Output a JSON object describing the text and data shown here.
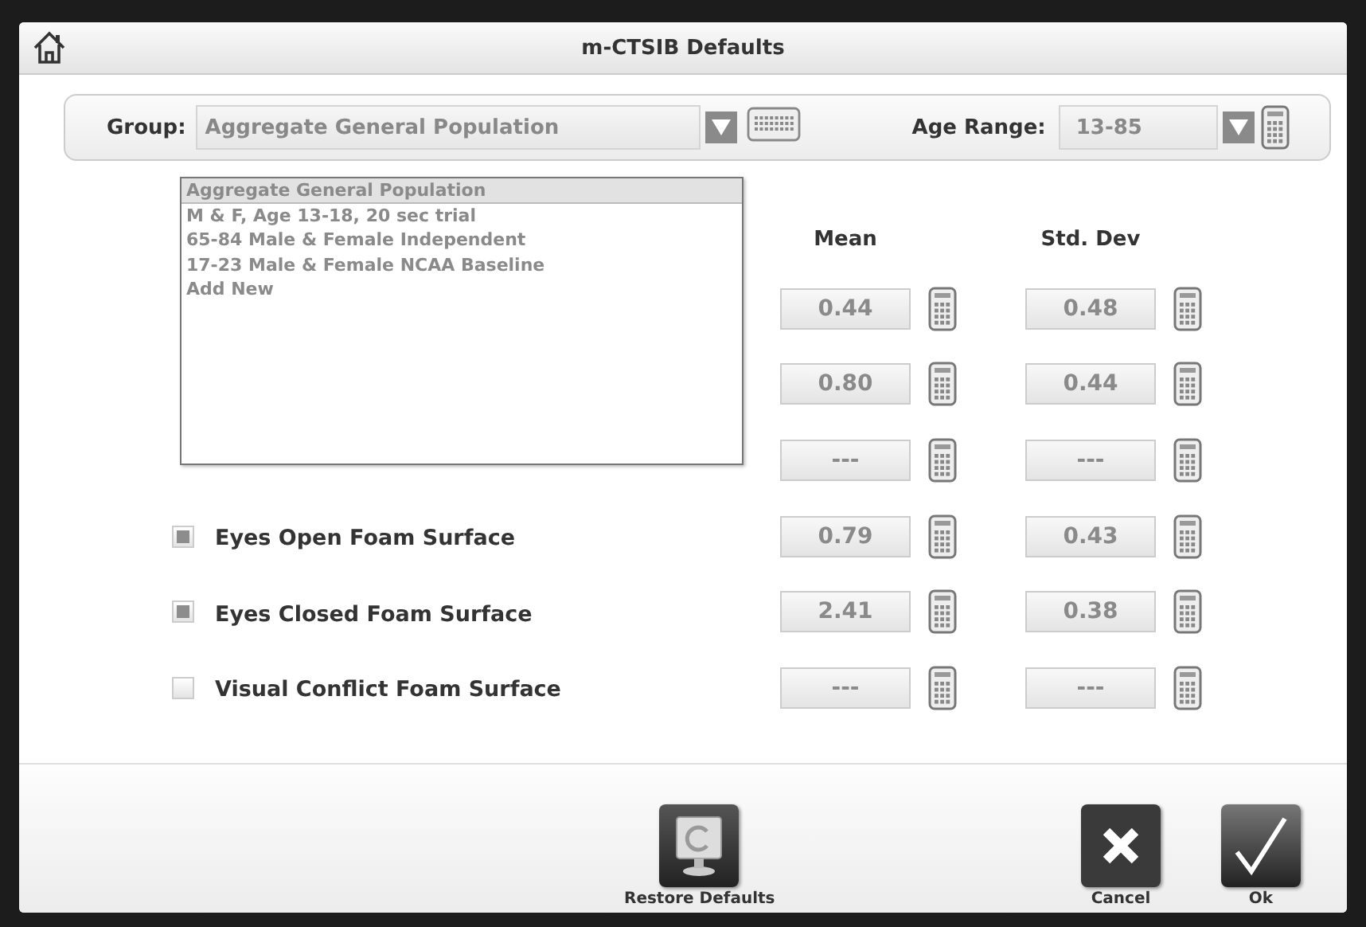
{
  "window": {
    "title": "m-CTSIB Defaults"
  },
  "group": {
    "label": "Group:",
    "value": "Aggregate General Population",
    "expanded": true,
    "options": [
      {
        "label": "Aggregate General Population",
        "selected": true
      },
      {
        "label": "M & F, Age 13-18, 20 sec trial",
        "selected": false
      },
      {
        "label": "65-84 Male & Female Independent",
        "selected": false
      },
      {
        "label": "17-23 Male & Female NCAA Baseline",
        "selected": false
      },
      {
        "label": "Add New",
        "selected": false
      }
    ]
  },
  "age_range": {
    "label": "Age Range:",
    "value": "13-85"
  },
  "columns": [
    "Mean",
    "Std. Dev"
  ],
  "conditions": [
    {
      "mean": "0.44",
      "std_dev": "0.48"
    },
    {
      "mean": "0.80",
      "std_dev": "0.44"
    },
    {
      "mean": "---",
      "std_dev": "---"
    },
    {
      "label": "Eyes Open Foam Surface",
      "checked": true,
      "mean": "0.79",
      "std_dev": "0.43"
    },
    {
      "label": "Eyes Closed Foam Surface",
      "checked": true,
      "mean": "2.41",
      "std_dev": "0.38"
    },
    {
      "label": "Visual Conflict Foam Surface",
      "checked": false,
      "mean": "---",
      "std_dev": "---"
    }
  ],
  "buttons": [
    {
      "label": "Restore Defaults",
      "kind": "restore"
    },
    {
      "label": "Cancel",
      "kind": "cancel"
    },
    {
      "label": "Ok",
      "kind": "ok"
    }
  ]
}
